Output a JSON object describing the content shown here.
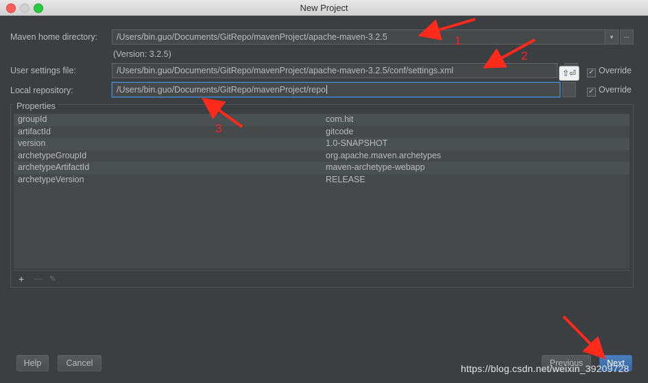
{
  "window": {
    "title": "New Project"
  },
  "maven_home": {
    "label": "Maven home directory:",
    "value": "/Users/bin.guo/Documents/GitRepo/mavenProject/apache-maven-3.2.5",
    "version_note": "(Version: 3.2.5)",
    "dropdown_glyph": "▾",
    "browse_glyph": "..."
  },
  "user_settings": {
    "label": "User settings file:",
    "value": "/Users/bin.guo/Documents/GitRepo/mavenProject/apache-maven-3.2.5/conf/settings.xml",
    "override_label": "Override",
    "override_checked": true,
    "tooltip": "⇧⏎"
  },
  "local_repo": {
    "label": "Local repository:",
    "value": "/Users/bin.guo/Documents/GitRepo/mavenProject/repo",
    "override_label": "Override",
    "override_checked": true
  },
  "properties": {
    "title": "Properties",
    "rows": [
      {
        "key": "groupId",
        "value": "com.hit"
      },
      {
        "key": "artifactId",
        "value": "gitcode"
      },
      {
        "key": "version",
        "value": "1.0-SNAPSHOT"
      },
      {
        "key": "archetypeGroupId",
        "value": "org.apache.maven.archetypes"
      },
      {
        "key": "archetypeArtifactId",
        "value": "maven-archetype-webapp"
      },
      {
        "key": "archetypeVersion",
        "value": "RELEASE"
      }
    ],
    "toolbar": {
      "add": "+",
      "remove": "—",
      "edit": "✎"
    }
  },
  "buttons": {
    "help": "Help",
    "cancel": "Cancel",
    "previous": "Previous",
    "next": "Next"
  },
  "annotations": {
    "numbers": [
      "1",
      "2",
      "3"
    ],
    "arrow_color": "#ff2a1a"
  },
  "watermark": "https://blog.csdn.net/weixin_39209728",
  "colors": {
    "background": "#3c3f41",
    "field": "#45494a",
    "focus": "#4a88c7",
    "primary": "#4a7fbf"
  }
}
